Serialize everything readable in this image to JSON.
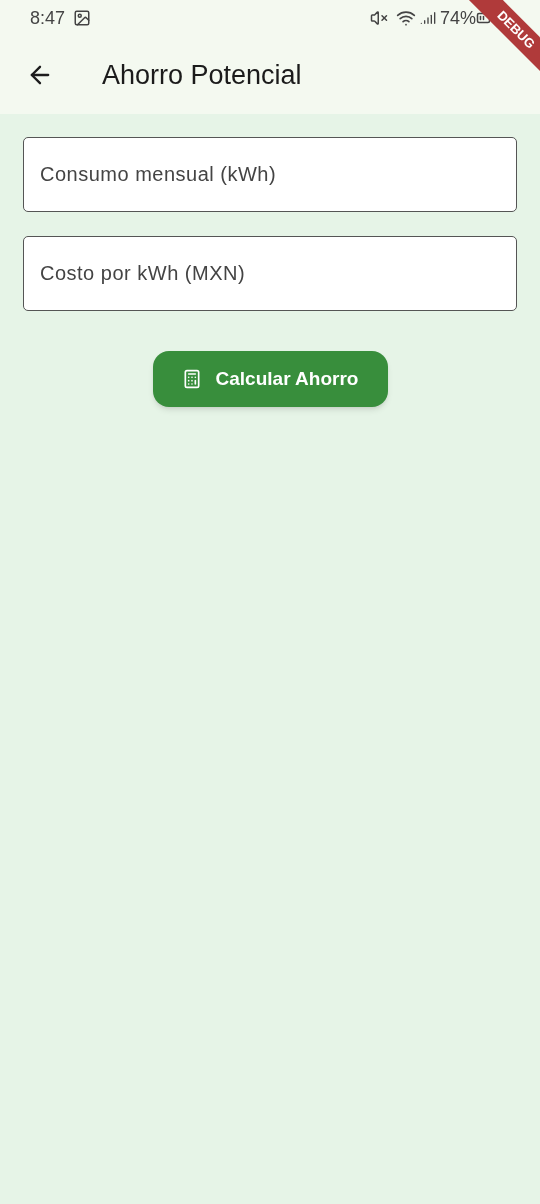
{
  "status_bar": {
    "time": "8:47",
    "battery": "74%"
  },
  "debug_banner": "DEBUG",
  "app_bar": {
    "title": "Ahorro Potencial"
  },
  "fields": [
    {
      "placeholder": "Consumo mensual (kWh)"
    },
    {
      "placeholder": "Costo por kWh (MXN)"
    }
  ],
  "button": {
    "label": "Calcular Ahorro"
  }
}
